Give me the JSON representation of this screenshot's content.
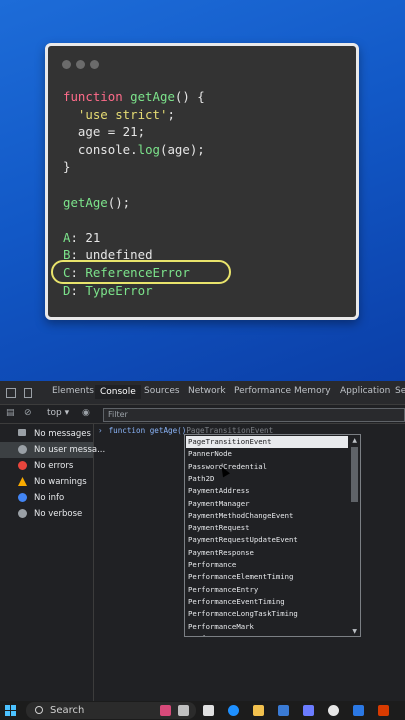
{
  "quiz": {
    "code_lines": [
      [
        "kw:function ",
        "fn:getAge",
        "plain:() {"
      ],
      [
        "plain:  ",
        "str:'use strict'",
        "plain:;"
      ],
      [
        "plain:  age = 21;"
      ],
      [
        "plain:  console.",
        "fn:log",
        "plain:(age);"
      ],
      [
        "plain:}"
      ],
      [
        "plain: "
      ],
      [
        "fn:getAge",
        "plain:();"
      ],
      [
        "plain: "
      ],
      [
        "ans:A",
        "ans-white:: 21"
      ],
      [
        "ans:B",
        "ans-white:: undefined"
      ],
      [
        "ans:C",
        "ans-white:: ",
        "ans:ReferenceError"
      ],
      [
        "ans:D",
        "ans-white:: ",
        "ans:TypeError"
      ]
    ]
  },
  "devtools": {
    "tabs": [
      "Elements",
      "Console",
      "Sources",
      "Network",
      "Performance",
      "Memory",
      "Application",
      "Se"
    ],
    "active_tab": "Console",
    "context": "top",
    "filter_placeholder": "Filter",
    "sidebar": [
      {
        "label": "No messages",
        "icon": "list-icon",
        "color": "#9aa0a6"
      },
      {
        "label": "No user messa...",
        "icon": "user-icon",
        "color": "#9aa0a6"
      },
      {
        "label": "No errors",
        "icon": "error-icon",
        "color": "#e8453c"
      },
      {
        "label": "No warnings",
        "icon": "warning-icon",
        "color": "#f9ab00"
      },
      {
        "label": "No info",
        "icon": "info-icon",
        "color": "#4285f4"
      },
      {
        "label": "No verbose",
        "icon": "bug-icon",
        "color": "#9aa0a6"
      }
    ],
    "console_input": "function getAge()",
    "console_ghost": "PageTransitionEvent",
    "autocomplete": [
      "PageTransitionEvent",
      "PannerNode",
      "PasswordCredential",
      "Path2D",
      "PaymentAddress",
      "PaymentManager",
      "PaymentMethodChangeEvent",
      "PaymentRequest",
      "PaymentRequestUpdateEvent",
      "PaymentResponse",
      "Performance",
      "PerformanceElementTiming",
      "PerformanceEntry",
      "PerformanceEventTiming",
      "PerformanceLongTaskTiming",
      "PerformanceMark",
      "PerformanceMeasure"
    ]
  },
  "taskbar": {
    "search_label": "Search"
  }
}
